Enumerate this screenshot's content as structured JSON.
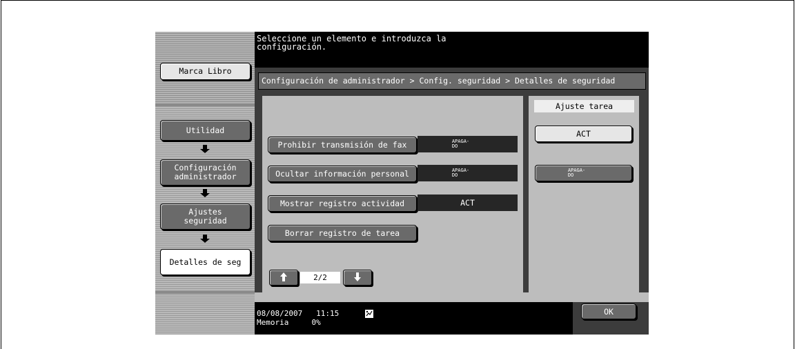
{
  "message": "Seleccione un elemento e introduzca la\nconfiguración.",
  "breadcrumb": "Configuración de administrador > Config. seguridad > Detalles de seguridad",
  "nav": {
    "bookmark": "Marca Libro",
    "utility": "Utilidad",
    "admin": "Configuración\nadministrador",
    "security": "Ajustes\nseguridad",
    "details": "Detalles de seg"
  },
  "settings": [
    {
      "label": "Prohibir transmisión de fax",
      "value": "APAGA-\nDO"
    },
    {
      "label": "Ocultar información personal",
      "value": "APAGA-\nDO"
    },
    {
      "label": "Mostrar registro actividad",
      "value": "ACT"
    }
  ],
  "clear_job_log": "Borrar registro de tarea",
  "job_settings": {
    "header": "Ajuste tarea",
    "on": "ACT",
    "off": "APAGA-\nDO"
  },
  "pagination": {
    "page": "2/2"
  },
  "status": {
    "date": "08/08/2007",
    "time": "11:15",
    "memory_label": "Memoria",
    "memory_value": "0%"
  },
  "ok_label": "OK",
  "icons": {
    "up": "arrow-up",
    "down": "arrow-down",
    "status": "network-status"
  }
}
